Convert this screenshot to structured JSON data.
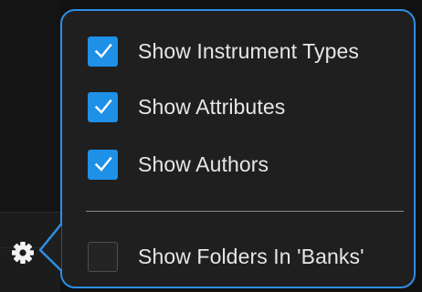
{
  "menu": {
    "items": [
      {
        "label": "Show Instrument Types",
        "checked": true
      },
      {
        "label": "Show Attributes",
        "checked": true
      },
      {
        "label": "Show Authors",
        "checked": true
      },
      {
        "label": "Show Folders In 'Banks'",
        "checked": false
      }
    ]
  },
  "icons": {
    "settings": "gear-icon",
    "checkmark": "checkmark-icon"
  },
  "colors": {
    "accent": "#2e8ee6",
    "checkbox_checked": "#1e90e8",
    "popup_background": "#1f1f1f",
    "text": "#e6e6e6"
  }
}
